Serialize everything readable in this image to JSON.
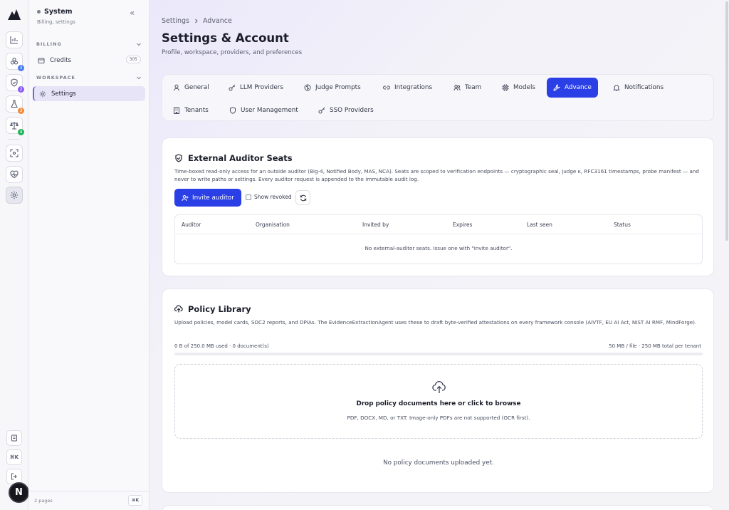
{
  "rail": {
    "badges": [
      "3",
      "2",
      "3",
      "4"
    ],
    "colors": {
      "blue": "#4a7cf0",
      "purple": "#8b5cf6",
      "orange": "#f08a3a",
      "green": "#22b35a"
    },
    "kbd_label": "⌘K",
    "avatar_letter": "N"
  },
  "sidebar": {
    "title": "System",
    "subtitle": "Billing, settings",
    "sections": {
      "billing": "BILLING",
      "workspace": "WORKSPACE"
    },
    "credits_label": "Credits",
    "credits_count": "305",
    "settings_label": "Settings",
    "footer_pages": "2 pages",
    "footer_kbd": "⌘K"
  },
  "header": {
    "breadcrumb_parent": "Settings",
    "breadcrumb_current": "Advance",
    "title": "Settings & Account",
    "subtitle": "Profile, workspace, providers, and preferences"
  },
  "tabs": [
    {
      "label": "General",
      "icon": "user-icon"
    },
    {
      "label": "LLM Providers",
      "icon": "key-icon"
    },
    {
      "label": "Judge Prompts",
      "icon": "brain-icon"
    },
    {
      "label": "Integrations",
      "icon": "link-icon"
    },
    {
      "label": "Team",
      "icon": "users-icon"
    },
    {
      "label": "Models",
      "icon": "cpu-icon"
    },
    {
      "label": "Advance",
      "icon": "wrench-icon"
    },
    {
      "label": "Notifications",
      "icon": "bell-icon"
    },
    {
      "label": "Tenants",
      "icon": "building-icon"
    },
    {
      "label": "User Management",
      "icon": "shield-icon"
    },
    {
      "label": "SSO Providers",
      "icon": "key-icon"
    }
  ],
  "active_tab": "Advance",
  "auditor": {
    "title": "External Auditor Seats",
    "description": "Time-boxed read-only access for an outside auditor (Big-4, Notified Body, MAS, NCA). Seats are scoped to verification endpoints — cryptographic seal, judge κ, RFC3161 timestamps, probe manifest — and never to write paths or settings. Every auditor request is appended to the immutable audit log.",
    "invite_label": "Invite auditor",
    "show_revoked_label": "Show revoked",
    "columns": [
      "Auditor",
      "Organisation",
      "Invited by",
      "Expires",
      "Last seen",
      "Status"
    ],
    "empty_text": "No external-auditor seats. Issue one with \"Invite auditor\"."
  },
  "policy": {
    "title": "Policy Library",
    "description": "Upload policies, model cards, SOC2 reports, and DPIAs. The EvidenceExtractionAgent uses these to draft byte-verified attestations on every framework console (AIVTF, EU AI Act, NIST AI RMF, MindForge).",
    "usage_text": "0 B of 250.0 MB used · 0 document(s)",
    "limits_text": "50 MB / file · 250 MB total per tenant",
    "usage_fraction": 0,
    "drop_title": "Drop policy documents here or click to browse",
    "drop_subtitle": "PDF, DOCX, MD, or TXT. Image-only PDFs are not supported (OCR first).",
    "empty_text": "No policy documents uploaded yet."
  }
}
